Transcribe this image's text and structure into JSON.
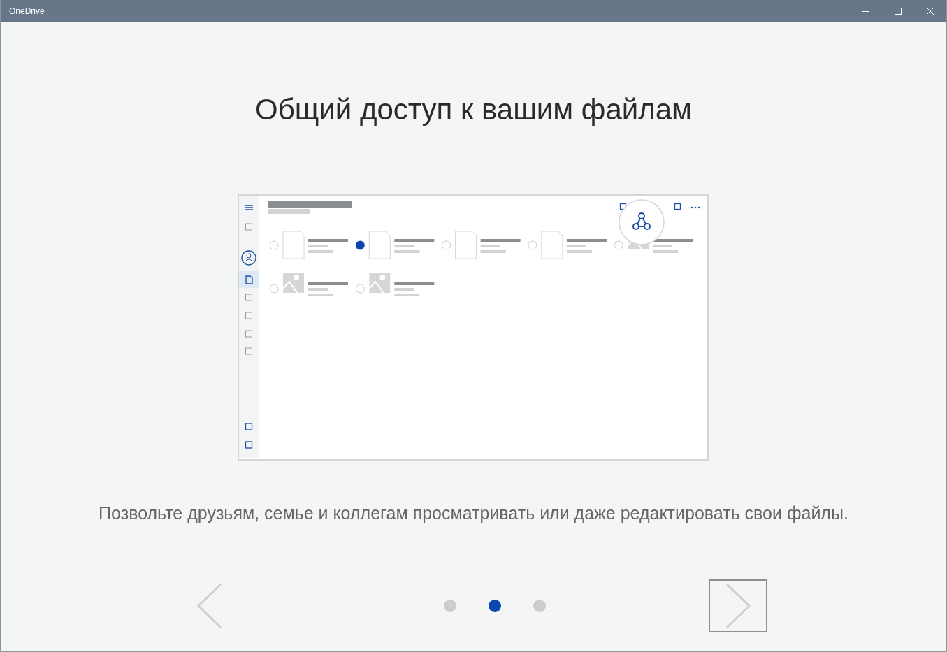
{
  "window": {
    "title": "OneDrive"
  },
  "heading": "Общий доступ к вашим файлам",
  "description": "Позвольте друзьям, семье и коллегам просматривать или даже редактировать свои файлы.",
  "pager": [
    {
      "selected": false
    },
    {
      "selected": true
    },
    {
      "selected": false
    }
  ]
}
